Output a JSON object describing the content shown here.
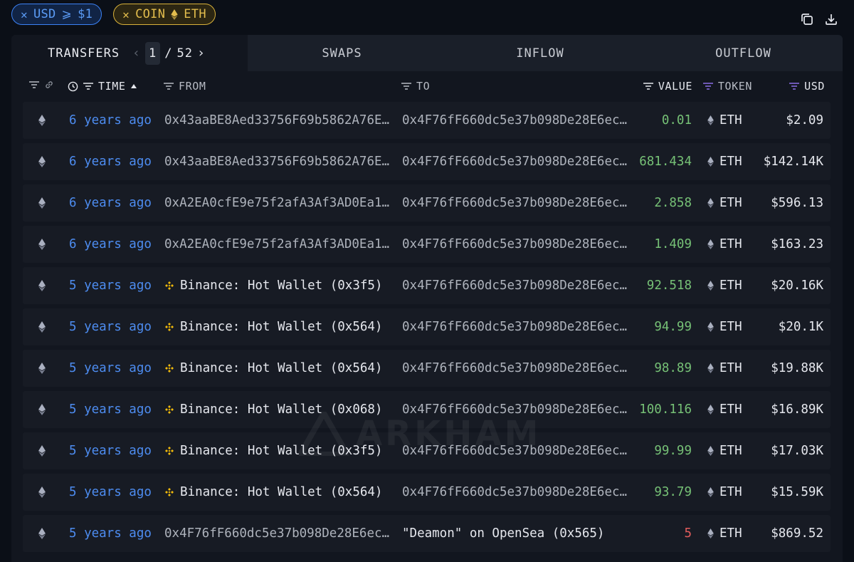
{
  "filters": {
    "usd_chip": {
      "close": "✕",
      "label": "USD",
      "op": "⩾",
      "value": "$1"
    },
    "coin_chip": {
      "close": "✕",
      "label": "COIN",
      "value": "ETH"
    }
  },
  "tabs": {
    "transfers": "TRANSFERS",
    "page_current": "1",
    "page_sep": "/",
    "page_total": "52",
    "swaps": "SWAPS",
    "inflow": "INFLOW",
    "outflow": "OUTFLOW"
  },
  "columns": {
    "time": "TIME",
    "from": "FROM",
    "to": "TO",
    "value": "VALUE",
    "token": "TOKEN",
    "usd": "USD"
  },
  "watermark": "ARKHAM",
  "colors": {
    "accent_blue": "#4d8cf0",
    "coin_gold": "#e3bd4d",
    "value_green": "#76c176",
    "value_red": "#e25c5c",
    "binance_yellow": "#f0b90b"
  },
  "rows": [
    {
      "time": "6 years ago",
      "from": "0x43aaBE8Aed33756F69b5862A76E…",
      "from_type": "address",
      "to": "0x4F76fF660dc5e37b098De28E6ec…",
      "to_type": "address",
      "value": "0.01",
      "value_color": "green",
      "token": "ETH",
      "usd": "$2.09"
    },
    {
      "time": "6 years ago",
      "from": "0x43aaBE8Aed33756F69b5862A76E…",
      "from_type": "address",
      "to": "0x4F76fF660dc5e37b098De28E6ec…",
      "to_type": "address",
      "value": "681.434",
      "value_color": "green",
      "token": "ETH",
      "usd": "$142.14K"
    },
    {
      "time": "6 years ago",
      "from": "0xA2EA0cfE9e75f2afA3Af3AD0Ea1…",
      "from_type": "address",
      "to": "0x4F76fF660dc5e37b098De28E6ec…",
      "to_type": "address",
      "value": "2.858",
      "value_color": "green",
      "token": "ETH",
      "usd": "$596.13"
    },
    {
      "time": "6 years ago",
      "from": "0xA2EA0cfE9e75f2afA3Af3AD0Ea1…",
      "from_type": "address",
      "to": "0x4F76fF660dc5e37b098De28E6ec…",
      "to_type": "address",
      "value": "1.409",
      "value_color": "green",
      "token": "ETH",
      "usd": "$163.23"
    },
    {
      "time": "5 years ago",
      "from": "Binance: Hot Wallet (0x3f5)",
      "from_type": "binance",
      "to": "0x4F76fF660dc5e37b098De28E6ec…",
      "to_type": "address",
      "value": "92.518",
      "value_color": "green",
      "token": "ETH",
      "usd": "$20.16K"
    },
    {
      "time": "5 years ago",
      "from": "Binance: Hot Wallet (0x564)",
      "from_type": "binance",
      "to": "0x4F76fF660dc5e37b098De28E6ec…",
      "to_type": "address",
      "value": "94.99",
      "value_color": "green",
      "token": "ETH",
      "usd": "$20.1K"
    },
    {
      "time": "5 years ago",
      "from": "Binance: Hot Wallet (0x564)",
      "from_type": "binance",
      "to": "0x4F76fF660dc5e37b098De28E6ec…",
      "to_type": "address",
      "value": "98.89",
      "value_color": "green",
      "token": "ETH",
      "usd": "$19.88K"
    },
    {
      "time": "5 years ago",
      "from": "Binance: Hot Wallet (0x068)",
      "from_type": "binance",
      "to": "0x4F76fF660dc5e37b098De28E6ec…",
      "to_type": "address",
      "value": "100.116",
      "value_color": "green",
      "token": "ETH",
      "usd": "$16.89K"
    },
    {
      "time": "5 years ago",
      "from": "Binance: Hot Wallet (0x3f5)",
      "from_type": "binance",
      "to": "0x4F76fF660dc5e37b098De28E6ec…",
      "to_type": "address",
      "value": "99.99",
      "value_color": "green",
      "token": "ETH",
      "usd": "$17.03K"
    },
    {
      "time": "5 years ago",
      "from": "Binance: Hot Wallet (0x564)",
      "from_type": "binance",
      "to": "0x4F76fF660dc5e37b098De28E6ec…",
      "to_type": "address",
      "value": "93.79",
      "value_color": "green",
      "token": "ETH",
      "usd": "$15.59K"
    },
    {
      "time": "5 years ago",
      "from": "0x4F76fF660dc5e37b098De28E6ec…",
      "from_type": "address",
      "to": "\"Deamon\" on OpenSea (0x565)",
      "to_type": "entity",
      "value": "5",
      "value_color": "red",
      "token": "ETH",
      "usd": "$869.52"
    }
  ]
}
